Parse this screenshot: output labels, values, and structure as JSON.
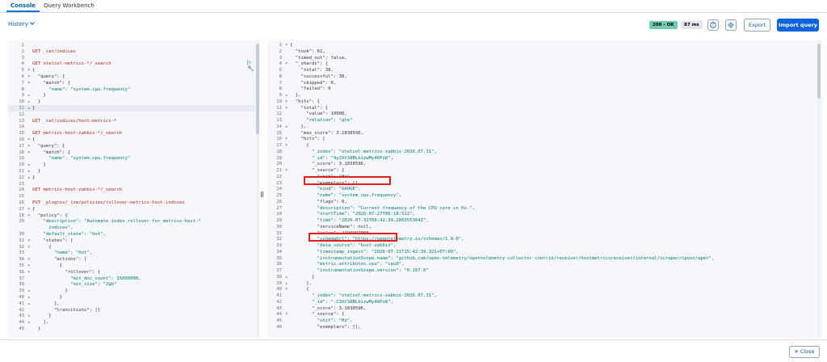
{
  "tabs": [
    {
      "label": "Console",
      "active": true
    },
    {
      "label": "Query Workbench",
      "active": false
    }
  ],
  "toolbar": {
    "history_label": "History",
    "status": "200 - OK",
    "time": "87 ms",
    "export_label": "Export",
    "import_label": "Import query",
    "icons": [
      "help-icon",
      "settings-gear-icon"
    ]
  },
  "colors": {
    "accent": "#0b64dd",
    "status_ok": "#6dccb1",
    "method": "#bd271e",
    "string": "#017d73",
    "highlight": "#e0201b"
  },
  "request_editor": {
    "lines": [
      {
        "n": "1",
        "fold": "",
        "text": ""
      },
      {
        "n": "2",
        "fold": "",
        "text": "GET _cat/indices",
        "kind": "method"
      },
      {
        "n": "3",
        "fold": "",
        "text": ""
      },
      {
        "n": "4",
        "fold": "",
        "text": "GET otelcol-metrics-*/_search",
        "kind": "method"
      },
      {
        "n": "5",
        "fold": "▾",
        "text": "{"
      },
      {
        "n": "6",
        "fold": "▾",
        "text": "  \"query\": {"
      },
      {
        "n": "7",
        "fold": "▾",
        "text": "    \"match\": {"
      },
      {
        "n": "8",
        "fold": "",
        "text": "      \"name\": \"system.cpu.frequency\"",
        "kind": "str"
      },
      {
        "n": "9",
        "fold": "▴",
        "text": "    }"
      },
      {
        "n": "10",
        "fold": "▴",
        "text": "  }"
      },
      {
        "n": "11",
        "fold": "▴",
        "text": "}",
        "current": true
      },
      {
        "n": "12",
        "fold": "",
        "text": ""
      },
      {
        "n": "13",
        "fold": "",
        "text": "GET _cat/indices/host-metrics-*",
        "kind": "method"
      },
      {
        "n": "14",
        "fold": "",
        "text": ""
      },
      {
        "n": "15",
        "fold": "",
        "text": "GET metrics-host-zabbix-*/_search",
        "kind": "method"
      },
      {
        "n": "16",
        "fold": "▾",
        "text": "{"
      },
      {
        "n": "17",
        "fold": "▾",
        "text": "  \"query\": {"
      },
      {
        "n": "18",
        "fold": "▾",
        "text": "    \"match\": {"
      },
      {
        "n": "19",
        "fold": "",
        "text": "      \"name\": \"system.cpu.frequency\"",
        "kind": "str"
      },
      {
        "n": "20",
        "fold": "▴",
        "text": "    }"
      },
      {
        "n": "21",
        "fold": "▴",
        "text": "  }"
      },
      {
        "n": "22",
        "fold": "▴",
        "text": "}"
      },
      {
        "n": "23",
        "fold": "",
        "text": ""
      },
      {
        "n": "24",
        "fold": "",
        "text": "GET metrics-host-zabbix-*/_search",
        "kind": "method"
      },
      {
        "n": "25",
        "fold": "",
        "text": ""
      },
      {
        "n": "26",
        "fold": "",
        "text": "PUT _plugins/_ism/policies/rollover-metrics-host-indices",
        "kind": "method"
      },
      {
        "n": "27",
        "fold": "▾",
        "text": "{"
      },
      {
        "n": "28",
        "fold": "▾",
        "text": "  \"policy\": {"
      },
      {
        "n": "29",
        "fold": "",
        "text": "    \"description\": \"Automate index rollover for metrics-host-*",
        "kind": "str"
      },
      {
        "n": "",
        "fold": "",
        "text": "      indices\",",
        "kind": "str"
      },
      {
        "n": "30",
        "fold": "",
        "text": "    \"default_state\": \"hot\",",
        "kind": "str"
      },
      {
        "n": "31",
        "fold": "▾",
        "text": "    \"states\": ["
      },
      {
        "n": "32",
        "fold": "▾",
        "text": "      {"
      },
      {
        "n": "33",
        "fold": "",
        "text": "        \"name\": \"hot\",",
        "kind": "str"
      },
      {
        "n": "34",
        "fold": "▾",
        "text": "        \"actions\": ["
      },
      {
        "n": "35",
        "fold": "▾",
        "text": "          {"
      },
      {
        "n": "36",
        "fold": "▾",
        "text": "            \"rollover\": {"
      },
      {
        "n": "37",
        "fold": "",
        "text": "              \"min_doc_count\": 15000000,",
        "kind": "str"
      },
      {
        "n": "38",
        "fold": "",
        "text": "              \"min_size\": \"2gb\"",
        "kind": "str"
      },
      {
        "n": "39",
        "fold": "▴",
        "text": "            }"
      },
      {
        "n": "40",
        "fold": "▴",
        "text": "          }"
      },
      {
        "n": "41",
        "fold": "▴",
        "text": "        ],"
      },
      {
        "n": "42",
        "fold": "",
        "text": "        \"transitions\": []"
      },
      {
        "n": "43",
        "fold": "▴",
        "text": "      }"
      },
      {
        "n": "44",
        "fold": "▴",
        "text": "    ],"
      },
      {
        "n": "45",
        "fold": "",
        "text": "  }"
      }
    ]
  },
  "response_viewer": {
    "lines": [
      {
        "n": "1",
        "fold": "▾",
        "text": "{"
      },
      {
        "n": "2",
        "fold": "",
        "text": "  \"took\": 61,"
      },
      {
        "n": "3",
        "fold": "",
        "text": "  \"timed_out\": false,"
      },
      {
        "n": "4",
        "fold": "▾",
        "text": "  \"_shards\": {"
      },
      {
        "n": "5",
        "fold": "",
        "text": "    \"total\": 38,"
      },
      {
        "n": "6",
        "fold": "",
        "text": "    \"successful\": 38,"
      },
      {
        "n": "7",
        "fold": "",
        "text": "    \"skipped\": 0,"
      },
      {
        "n": "8",
        "fold": "",
        "text": "    \"failed\": 0"
      },
      {
        "n": "9",
        "fold": "▴",
        "text": "  },"
      },
      {
        "n": "10",
        "fold": "▾",
        "text": "  \"hits\": {"
      },
      {
        "n": "11",
        "fold": "▾",
        "text": "    \"total\": {"
      },
      {
        "n": "12",
        "fold": "",
        "text": "      \"value\": 10000,"
      },
      {
        "n": "13",
        "fold": "",
        "text": "      \"relation\": \"gte\"",
        "kind": "str"
      },
      {
        "n": "14",
        "fold": "▴",
        "text": "    },"
      },
      {
        "n": "15",
        "fold": "",
        "text": "    \"max_score\": 3.1838596,"
      },
      {
        "n": "16",
        "fold": "▾",
        "text": "    \"hits\": ["
      },
      {
        "n": "17",
        "fold": "▾",
        "text": "      {"
      },
      {
        "n": "18",
        "fold": "",
        "text": "        \"_index\": \"otelcol-metrics-zabbix-2026.07.31\",",
        "kind": "str"
      },
      {
        "n": "19",
        "fold": "",
        "text": "        \"_id\": \"9yJXtS8BLkizwMy46Po8\",",
        "kind": "str"
      },
      {
        "n": "20",
        "fold": "",
        "text": "        \"_score\": 3.1838596,"
      },
      {
        "n": "21",
        "fold": "▾",
        "text": "        \"_source\": {"
      },
      {
        "n": "22",
        "fold": "",
        "text": "          \"unit\": \"Hz\",",
        "kind": "str"
      },
      {
        "n": "23",
        "fold": "",
        "text": "          \"exemplars\": [],"
      },
      {
        "n": "24",
        "fold": "",
        "text": "          \"kind\": \"GAUGE\",",
        "kind": "str"
      },
      {
        "n": "25",
        "fold": "",
        "text": "          \"name\": \"system.cpu.frequency\",",
        "kind": "str"
      },
      {
        "n": "26",
        "fold": "",
        "text": "          \"flags\": 0,"
      },
      {
        "n": "27",
        "fold": "",
        "text": "          \"description\": \"Current frequency of the CPU core in Hz.\",",
        "kind": "str"
      },
      {
        "n": "28",
        "fold": "",
        "text": "          \"startTime\": \"2026-07-27T06:18:52Z\",",
        "kind": "str"
      },
      {
        "n": "29",
        "fold": "",
        "text": "          \"time\": \"2026-07-31T08:42:39.280355364Z\",",
        "kind": "str"
      },
      {
        "n": "30",
        "fold": "",
        "text": "          \"serviceName\": null,"
      },
      {
        "n": "31",
        "fold": "",
        "text": "          \"value\": 2199997000,"
      },
      {
        "n": "32",
        "fold": "",
        "text": "          \"schemaUrl\": \"https://opentelemetry.io/schemas/1.9.0\",",
        "kind": "str"
      },
      {
        "n": "33",
        "fold": "",
        "text": "          \"data_source\": \"host-zabbix\",",
        "kind": "str"
      },
      {
        "n": "34",
        "fold": "",
        "text": "          \"timestamp_ingest\": \"2026-07-31T15:42:39.321+07:00\",",
        "kind": "str"
      },
      {
        "n": "35",
        "fold": "",
        "text": "          \"instrumentationScope.name\": \"github.com/open-telemetry/opentelemetry-collector-contrib/receiver/hostmetricsreceiver/internal/scraper/cpuscraper\",",
        "kind": "str"
      },
      {
        "n": "36",
        "fold": "",
        "text": "          \"metric.attributes.cpu\": \"cpu0\",",
        "kind": "str"
      },
      {
        "n": "37",
        "fold": "",
        "text": "          \"instrumentationScope.version\": \"0.157.0\"",
        "kind": "str"
      },
      {
        "n": "38",
        "fold": "▴",
        "text": "        }"
      },
      {
        "n": "39",
        "fold": "▴",
        "text": "      },"
      },
      {
        "n": "40",
        "fold": "▾",
        "text": "      {"
      },
      {
        "n": "41",
        "fold": "",
        "text": "        \"_index\": \"otelcol-metrics-zabbix-2026.07.31\",",
        "kind": "str"
      },
      {
        "n": "42",
        "fold": "",
        "text": "        \"_id\": \"-C3XtS8BLkizwMy46Po8\",",
        "kind": "str"
      },
      {
        "n": "43",
        "fold": "",
        "text": "        \"_score\": 3.1838596,"
      },
      {
        "n": "44",
        "fold": "▾",
        "text": "        \"_source\": {"
      },
      {
        "n": "45",
        "fold": "",
        "text": "          \"unit\": \"Hz\",",
        "kind": "str"
      },
      {
        "n": "46",
        "fold": "",
        "text": "          \"exemplars\": [],"
      }
    ]
  },
  "footer": {
    "close_label": "Close"
  }
}
